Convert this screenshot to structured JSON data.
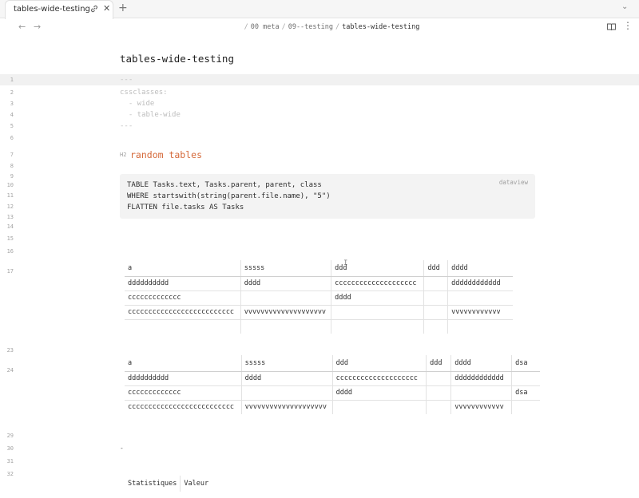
{
  "tab": {
    "title": "tables-wide-testing"
  },
  "breadcrumb": {
    "part1": "00 meta",
    "part2": "09--testing",
    "current": "tables-wide-testing",
    "separator": "/"
  },
  "note": {
    "title": "tables-wide-testing"
  },
  "line_numbers": [
    "1",
    "2",
    "3",
    "4",
    "5",
    "6",
    "7",
    "8",
    "9",
    "10",
    "11",
    "12",
    "13",
    "14",
    "15",
    "16",
    "17",
    "23",
    "24",
    "29",
    "30",
    "31",
    "32"
  ],
  "frontmatter": {
    "open": "---",
    "key": "cssclasses:",
    "item1": "  - wide",
    "item2": "  - table-wide",
    "close": "---"
  },
  "heading": {
    "marker": "H2",
    "text": "random tables"
  },
  "code": {
    "lang": "dataview",
    "lines": [
      "TABLE Tasks.text, Tasks.parent, parent, class",
      "WHERE startswith(string(parent.file.name), \"5\")",
      "FLATTEN file.tasks AS Tasks"
    ]
  },
  "table1": {
    "headers": [
      "a",
      "sssss",
      "ddd",
      "ddd",
      "dddd"
    ],
    "rows": [
      [
        "dddddddddd",
        "dddd",
        "cccccccccccccccccccc",
        "",
        "dddddddddddd"
      ],
      [
        "ccccccccccccc",
        "",
        "dddd",
        "",
        ""
      ],
      [
        "cccccccccccccccccccccccccc",
        "vvvvvvvvvvvvvvvvvvvv",
        "",
        "",
        "vvvvvvvvvvvv"
      ],
      [
        "",
        "",
        "",
        "",
        ""
      ]
    ]
  },
  "table2": {
    "headers": [
      "a",
      "sssss",
      "ddd",
      "ddd",
      "dddd",
      "dsa"
    ],
    "rows": [
      [
        "dddddddddd",
        "dddd",
        "cccccccccccccccccccc",
        "",
        "dddddddddddd",
        ""
      ],
      [
        "ccccccccccccc",
        "",
        "dddd",
        "",
        "",
        "dsa"
      ],
      [
        "cccccccccccccccccccccccccc",
        "vvvvvvvvvvvvvvvvvvvv",
        "",
        "",
        "vvvvvvvvvvvv",
        ""
      ]
    ]
  },
  "cursor_glyph": "I",
  "hr_text": "-",
  "stats_table": {
    "headers": [
      "Statistiques",
      "Valeur"
    ]
  }
}
